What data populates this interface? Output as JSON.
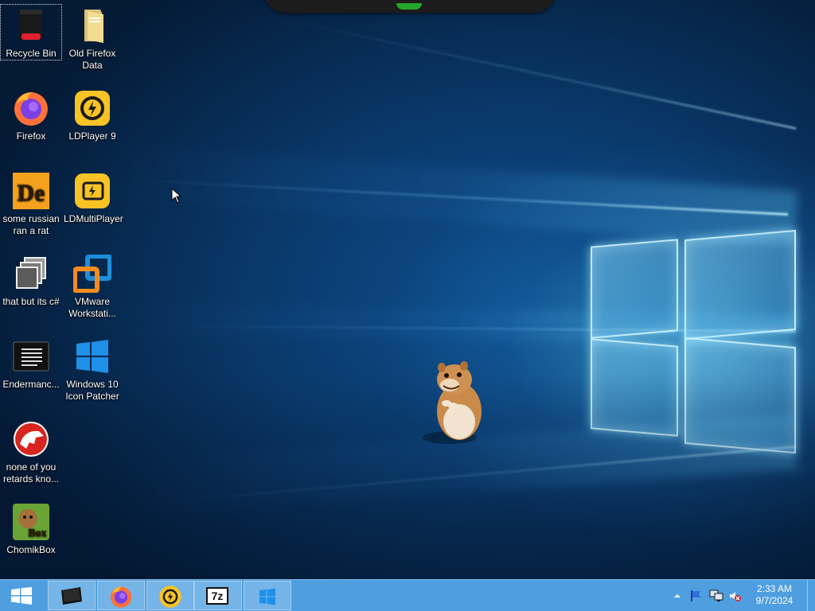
{
  "desktop": {
    "icons": [
      {
        "label": "Recycle Bin"
      },
      {
        "label": "Old Firefox Data"
      },
      {
        "label": "Firefox"
      },
      {
        "label": "LDPlayer 9"
      },
      {
        "label": "some russian ran a rat"
      },
      {
        "label": "LDMultiPlayer"
      },
      {
        "label": "that but its c#"
      },
      {
        "label": "VMware Workstati..."
      },
      {
        "label": "Endermanc..."
      },
      {
        "label": "Windows 10 Icon Patcher"
      },
      {
        "label": "none of you retards kno..."
      },
      {
        "label": "ChomikBox"
      }
    ]
  },
  "taskbar": {
    "pinned": [
      {
        "icon": "terminal-icon"
      },
      {
        "icon": "firefox-icon"
      },
      {
        "icon": "ldplayer-icon"
      },
      {
        "icon": "7zip-icon",
        "text": "7z"
      },
      {
        "icon": "windows-logo-icon"
      }
    ],
    "tray": {
      "time": "2:33 AM",
      "date": "9/7/2024"
    }
  },
  "colors": {
    "taskbar": "#4f9fe0",
    "wallpaper": "#0a3a6c"
  }
}
